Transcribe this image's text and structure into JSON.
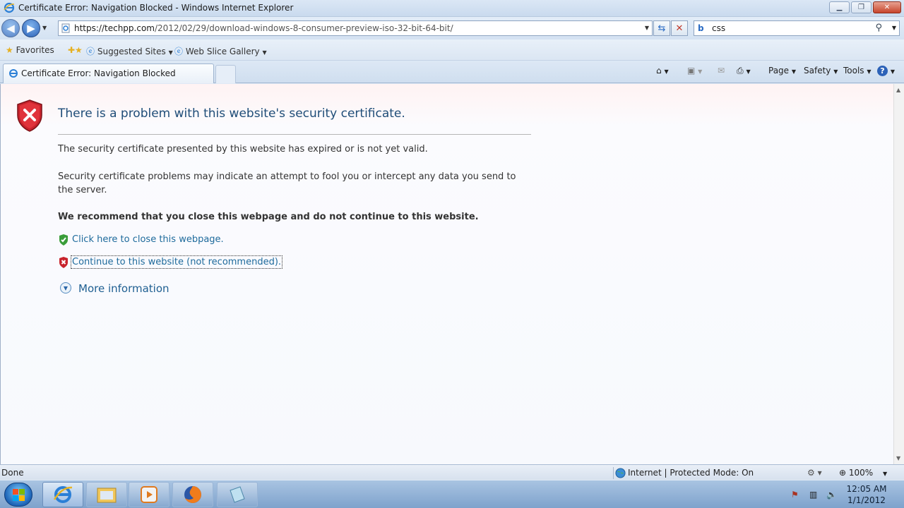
{
  "window": {
    "title": "Certificate Error: Navigation Blocked - Windows Internet Explorer",
    "controls": {
      "minimize": "▁",
      "maximize": "❐",
      "close": "✕"
    }
  },
  "navigation": {
    "url_host": "https://techpp.com",
    "url_path": "/2012/02/29/download-windows-8-consumer-preview-iso-32-bit-64-bit/",
    "search_query": "css"
  },
  "favorites_bar": {
    "favorites_label": "Favorites",
    "items": [
      "Suggested Sites",
      "Web Slice Gallery"
    ]
  },
  "tabs": [
    {
      "label": "Certificate Error: Navigation Blocked"
    }
  ],
  "command_bar": {
    "page": "Page",
    "safety": "Safety",
    "tools": "Tools"
  },
  "page": {
    "heading": "There is a problem with this website's security certificate.",
    "paragraph1": "The security certificate presented by this website has expired or is not yet valid.",
    "paragraph2": "Security certificate problems may indicate an attempt to fool you or intercept any data you send to the server.",
    "recommendation": "We recommend that you close this webpage and do not continue to this website.",
    "close_link": "Click here to close this webpage.",
    "continue_link": "Continue to this website (not recommended).",
    "more_info": "More information"
  },
  "status_bar": {
    "status": "Done",
    "zone": "Internet | Protected Mode: On",
    "zoom": "100%"
  },
  "taskbar": {
    "time": "12:05 AM",
    "date": "1/1/2012"
  }
}
